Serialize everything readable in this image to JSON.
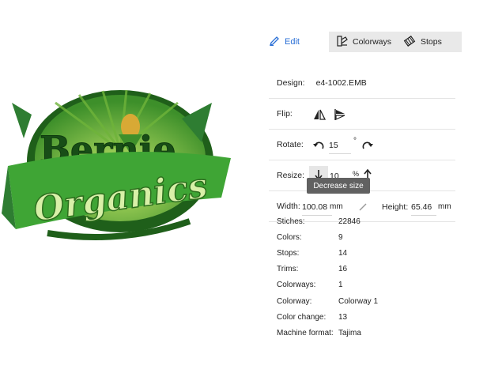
{
  "toolbar": {
    "edit_label": "Edit",
    "tabs": [
      {
        "label": "Colorways",
        "icon": "swatch-book-icon"
      },
      {
        "label": "Stops",
        "icon": "thread-spool-icon"
      }
    ]
  },
  "design": {
    "label": "Design:",
    "value": "e4-1002.EMB"
  },
  "flip": {
    "label": "Flip:"
  },
  "rotate": {
    "label": "Rotate:",
    "value": "15",
    "unit": "°"
  },
  "resize": {
    "label": "Resize:",
    "value": "10",
    "unit": "%"
  },
  "tooltip": {
    "text": "Decrease size"
  },
  "dimensions": {
    "width_label": "Width:",
    "width_value": "100.08",
    "width_unit": "mm",
    "height_label": "Height:",
    "height_value": "65.46",
    "height_unit": "mm"
  },
  "stats": [
    {
      "key": "Stiches:",
      "value": "22846"
    },
    {
      "key": "Colors:",
      "value": "9"
    },
    {
      "key": "Stops:",
      "value": "14"
    },
    {
      "key": "Trims:",
      "value": "16"
    },
    {
      "key": "Colorways:",
      "value": "1"
    },
    {
      "key": "Colorway:",
      "value": "Colorway 1"
    },
    {
      "key": "Color change:",
      "value": "13"
    },
    {
      "key": "Machine format:",
      "value": "Tajima"
    }
  ],
  "logo": {
    "line1": "Bernie",
    "line2": "Organics"
  },
  "colors": {
    "accent": "#2a6fd6",
    "tab_bg": "#e9e9e9",
    "tooltip_bg": "#616161",
    "logo_dark": "#1f5f1a",
    "logo_light": "#8fd14f"
  }
}
